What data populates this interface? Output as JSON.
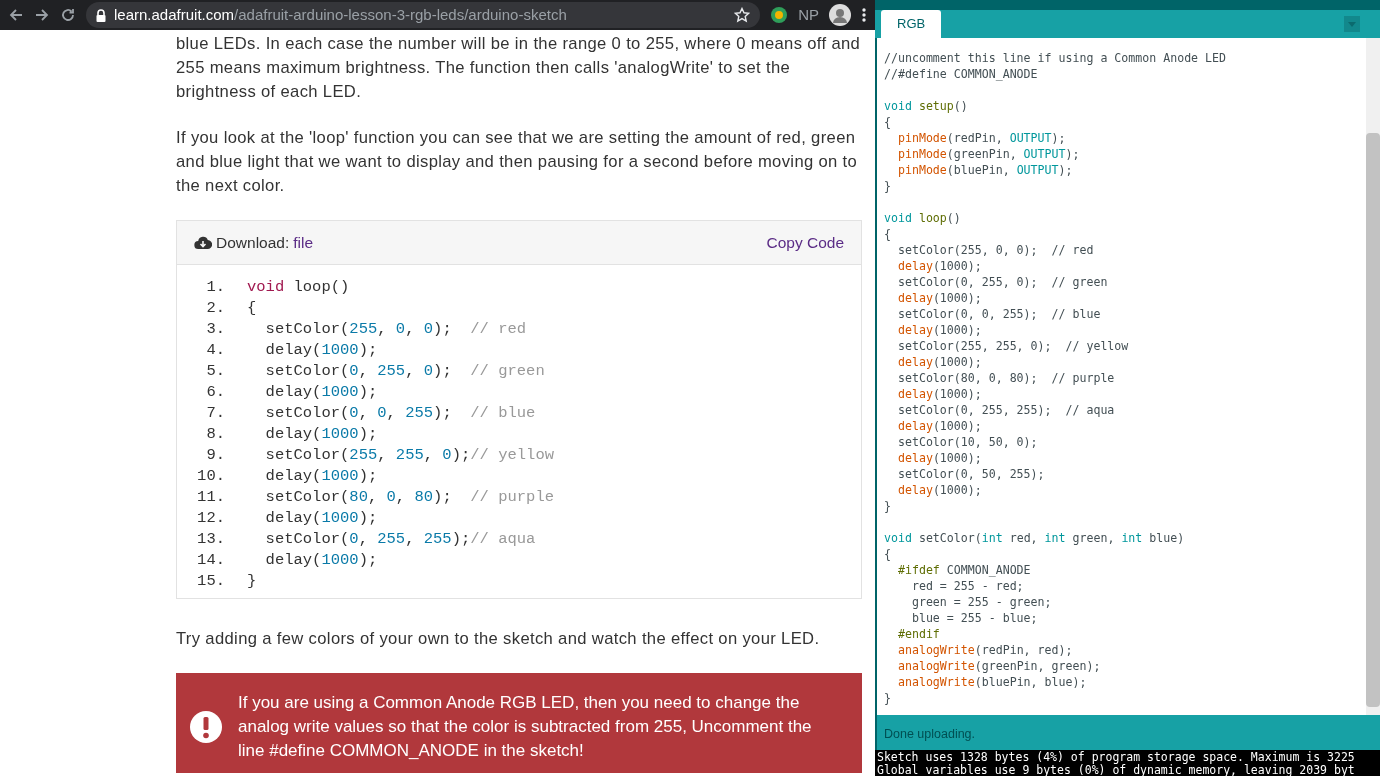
{
  "browser": {
    "url_host": "learn.adafruit.com",
    "url_path": "/adafruit-arduino-lesson-3-rgb-leds/arduino-sketch",
    "profile_initials": "NP"
  },
  "article": {
    "paragraphs": [
      "blue LEDs. In each case the number will be in the range 0 to 255, where 0 means off and 255 means maximum brightness. The function then calls 'analogWrite' to set the brightness of each LED.",
      "If you look at the 'loop' function you can see that we are setting the amount of red, green and blue light that we want to display and then pausing for a second before moving on to the next color."
    ],
    "code_card": {
      "download_label": "Download:",
      "download_link": "file",
      "copy_label": "Copy Code",
      "lines": [
        {
          "number": "1.",
          "tokens": [
            {
              "kind": "kw",
              "text": "void"
            },
            {
              "kind": "plain",
              "text": " loop()"
            }
          ]
        },
        {
          "number": "2.",
          "tokens": [
            {
              "kind": "plain",
              "text": "{"
            }
          ]
        },
        {
          "number": "3.",
          "tokens": [
            {
              "kind": "plain",
              "text": "  setColor("
            },
            {
              "kind": "num",
              "text": "255"
            },
            {
              "kind": "plain",
              "text": ", "
            },
            {
              "kind": "num",
              "text": "0"
            },
            {
              "kind": "plain",
              "text": ", "
            },
            {
              "kind": "num",
              "text": "0"
            },
            {
              "kind": "plain",
              "text": ");  "
            },
            {
              "kind": "comment",
              "text": "// red"
            }
          ]
        },
        {
          "number": "4.",
          "tokens": [
            {
              "kind": "plain",
              "text": "  delay("
            },
            {
              "kind": "num",
              "text": "1000"
            },
            {
              "kind": "plain",
              "text": ");"
            }
          ]
        },
        {
          "number": "5.",
          "tokens": [
            {
              "kind": "plain",
              "text": "  setColor("
            },
            {
              "kind": "num",
              "text": "0"
            },
            {
              "kind": "plain",
              "text": ", "
            },
            {
              "kind": "num",
              "text": "255"
            },
            {
              "kind": "plain",
              "text": ", "
            },
            {
              "kind": "num",
              "text": "0"
            },
            {
              "kind": "plain",
              "text": ");  "
            },
            {
              "kind": "comment",
              "text": "// green"
            }
          ]
        },
        {
          "number": "6.",
          "tokens": [
            {
              "kind": "plain",
              "text": "  delay("
            },
            {
              "kind": "num",
              "text": "1000"
            },
            {
              "kind": "plain",
              "text": ");"
            }
          ]
        },
        {
          "number": "7.",
          "tokens": [
            {
              "kind": "plain",
              "text": "  setColor("
            },
            {
              "kind": "num",
              "text": "0"
            },
            {
              "kind": "plain",
              "text": ", "
            },
            {
              "kind": "num",
              "text": "0"
            },
            {
              "kind": "plain",
              "text": ", "
            },
            {
              "kind": "num",
              "text": "255"
            },
            {
              "kind": "plain",
              "text": ");  "
            },
            {
              "kind": "comment",
              "text": "// blue"
            }
          ]
        },
        {
          "number": "8.",
          "tokens": [
            {
              "kind": "plain",
              "text": "  delay("
            },
            {
              "kind": "num",
              "text": "1000"
            },
            {
              "kind": "plain",
              "text": ");"
            }
          ]
        },
        {
          "number": "9.",
          "tokens": [
            {
              "kind": "plain",
              "text": "  setColor("
            },
            {
              "kind": "num",
              "text": "255"
            },
            {
              "kind": "plain",
              "text": ", "
            },
            {
              "kind": "num",
              "text": "255"
            },
            {
              "kind": "plain",
              "text": ", "
            },
            {
              "kind": "num",
              "text": "0"
            },
            {
              "kind": "plain",
              "text": ");"
            },
            {
              "kind": "comment",
              "text": "// yellow"
            }
          ]
        },
        {
          "number": "10.",
          "tokens": [
            {
              "kind": "plain",
              "text": "  delay("
            },
            {
              "kind": "num",
              "text": "1000"
            },
            {
              "kind": "plain",
              "text": ");"
            }
          ]
        },
        {
          "number": "11.",
          "tokens": [
            {
              "kind": "plain",
              "text": "  setColor("
            },
            {
              "kind": "num",
              "text": "80"
            },
            {
              "kind": "plain",
              "text": ", "
            },
            {
              "kind": "num",
              "text": "0"
            },
            {
              "kind": "plain",
              "text": ", "
            },
            {
              "kind": "num",
              "text": "80"
            },
            {
              "kind": "plain",
              "text": ");  "
            },
            {
              "kind": "comment",
              "text": "// purple"
            }
          ]
        },
        {
          "number": "12.",
          "tokens": [
            {
              "kind": "plain",
              "text": "  delay("
            },
            {
              "kind": "num",
              "text": "1000"
            },
            {
              "kind": "plain",
              "text": ");"
            }
          ]
        },
        {
          "number": "13.",
          "tokens": [
            {
              "kind": "plain",
              "text": "  setColor("
            },
            {
              "kind": "num",
              "text": "0"
            },
            {
              "kind": "plain",
              "text": ", "
            },
            {
              "kind": "num",
              "text": "255"
            },
            {
              "kind": "plain",
              "text": ", "
            },
            {
              "kind": "num",
              "text": "255"
            },
            {
              "kind": "plain",
              "text": ");"
            },
            {
              "kind": "comment",
              "text": "// aqua"
            }
          ]
        },
        {
          "number": "14.",
          "tokens": [
            {
              "kind": "plain",
              "text": "  delay("
            },
            {
              "kind": "num",
              "text": "1000"
            },
            {
              "kind": "plain",
              "text": ");"
            }
          ]
        },
        {
          "number": "15.",
          "tokens": [
            {
              "kind": "plain",
              "text": "}"
            }
          ]
        }
      ]
    },
    "after_code": "Try adding a few colors of your own to the sketch and watch the effect on your LED.",
    "warning": "If you are using a Common Anode RGB LED, then you need to change the analog write values so that the color is subtracted from 255, Uncomment the line #define COMMON_ANODE in the sketch!"
  },
  "ide": {
    "tabs": [
      {
        "label": "RGB",
        "selected": true
      }
    ],
    "blocks": [
      [
        [
          {
            "kind": "plain",
            "text": "//uncomment this line if using a Common Anode LED"
          }
        ],
        [
          {
            "kind": "plain",
            "text": "//#define COMMON_ANODE"
          }
        ]
      ],
      [
        [
          {
            "kind": "kw",
            "text": "void"
          },
          {
            "kind": "decl",
            "text": " setup"
          },
          {
            "kind": "plain",
            "text": "()"
          }
        ],
        [
          {
            "kind": "plain",
            "text": "{"
          }
        ],
        [
          {
            "kind": "fn",
            "text": "  pinMode"
          },
          {
            "kind": "plain",
            "text": "(redPin, "
          },
          {
            "kind": "const",
            "text": "OUTPUT"
          },
          {
            "kind": "plain",
            "text": ");"
          }
        ],
        [
          {
            "kind": "fn",
            "text": "  pinMode"
          },
          {
            "kind": "plain",
            "text": "(greenPin, "
          },
          {
            "kind": "const",
            "text": "OUTPUT"
          },
          {
            "kind": "plain",
            "text": ");"
          }
        ],
        [
          {
            "kind": "fn",
            "text": "  pinMode"
          },
          {
            "kind": "plain",
            "text": "(bluePin, "
          },
          {
            "kind": "const",
            "text": "OUTPUT"
          },
          {
            "kind": "plain",
            "text": ");"
          }
        ],
        [
          {
            "kind": "plain",
            "text": "}"
          }
        ]
      ],
      [
        [
          {
            "kind": "kw",
            "text": "void"
          },
          {
            "kind": "decl",
            "text": " loop"
          },
          {
            "kind": "plain",
            "text": "()"
          }
        ],
        [
          {
            "kind": "plain",
            "text": "{"
          }
        ],
        [
          {
            "kind": "plain",
            "text": "  setColor(255, 0, 0);  // red"
          }
        ],
        [
          {
            "kind": "fn",
            "text": "  delay"
          },
          {
            "kind": "plain",
            "text": "(1000);"
          }
        ],
        [
          {
            "kind": "plain",
            "text": "  setColor(0, 255, 0);  // green"
          }
        ],
        [
          {
            "kind": "fn",
            "text": "  delay"
          },
          {
            "kind": "plain",
            "text": "(1000);"
          }
        ],
        [
          {
            "kind": "plain",
            "text": "  setColor(0, 0, 255);  // blue"
          }
        ],
        [
          {
            "kind": "fn",
            "text": "  delay"
          },
          {
            "kind": "plain",
            "text": "(1000);"
          }
        ],
        [
          {
            "kind": "plain",
            "text": "  setColor(255, 255, 0);  // yellow"
          }
        ],
        [
          {
            "kind": "fn",
            "text": "  delay"
          },
          {
            "kind": "plain",
            "text": "(1000);"
          }
        ],
        [
          {
            "kind": "plain",
            "text": "  setColor(80, 0, 80);  // purple"
          }
        ],
        [
          {
            "kind": "fn",
            "text": "  delay"
          },
          {
            "kind": "plain",
            "text": "(1000);"
          }
        ],
        [
          {
            "kind": "plain",
            "text": "  setColor(0, 255, 255);  // aqua"
          }
        ],
        [
          {
            "kind": "fn",
            "text": "  delay"
          },
          {
            "kind": "plain",
            "text": "(1000);"
          }
        ],
        [
          {
            "kind": "plain",
            "text": "  setColor(10, 50, 0);"
          }
        ],
        [
          {
            "kind": "fn",
            "text": "  delay"
          },
          {
            "kind": "plain",
            "text": "(1000);"
          }
        ],
        [
          {
            "kind": "plain",
            "text": "  setColor(0, 50, 255);"
          }
        ],
        [
          {
            "kind": "fn",
            "text": "  delay"
          },
          {
            "kind": "plain",
            "text": "(1000);"
          }
        ],
        [
          {
            "kind": "plain",
            "text": "}"
          }
        ]
      ],
      [
        [
          {
            "kind": "kw",
            "text": "void"
          },
          {
            "kind": "plain",
            "text": " setColor("
          },
          {
            "kind": "kw",
            "text": "int"
          },
          {
            "kind": "plain",
            "text": " red, "
          },
          {
            "kind": "kw",
            "text": "int"
          },
          {
            "kind": "plain",
            "text": " green, "
          },
          {
            "kind": "kw",
            "text": "int"
          },
          {
            "kind": "plain",
            "text": " blue)"
          }
        ],
        [
          {
            "kind": "plain",
            "text": "{"
          }
        ],
        [
          {
            "kind": "pp",
            "text": "  #ifdef"
          },
          {
            "kind": "plain",
            "text": " COMMON_ANODE"
          }
        ],
        [
          {
            "kind": "plain",
            "text": "    red = 255 - red;"
          }
        ],
        [
          {
            "kind": "plain",
            "text": "    green = 255 - green;"
          }
        ],
        [
          {
            "kind": "plain",
            "text": "    blue = 255 - blue;"
          }
        ],
        [
          {
            "kind": "pp",
            "text": "  #endif"
          }
        ],
        [
          {
            "kind": "fn",
            "text": "  analogWrite"
          },
          {
            "kind": "plain",
            "text": "(redPin, red);"
          }
        ],
        [
          {
            "kind": "fn",
            "text": "  analogWrite"
          },
          {
            "kind": "plain",
            "text": "(greenPin, green);"
          }
        ],
        [
          {
            "kind": "fn",
            "text": "  analogWrite"
          },
          {
            "kind": "plain",
            "text": "(bluePin, blue);"
          }
        ],
        [
          {
            "kind": "plain",
            "text": "}"
          }
        ]
      ]
    ],
    "status": "Done uploading.",
    "console": [
      "Sketch uses 1328 bytes (4%) of program storage space. Maximum is 3225",
      "Global variables use 9 bytes (0%) of dynamic memory, leaving 2039 byt"
    ]
  }
}
